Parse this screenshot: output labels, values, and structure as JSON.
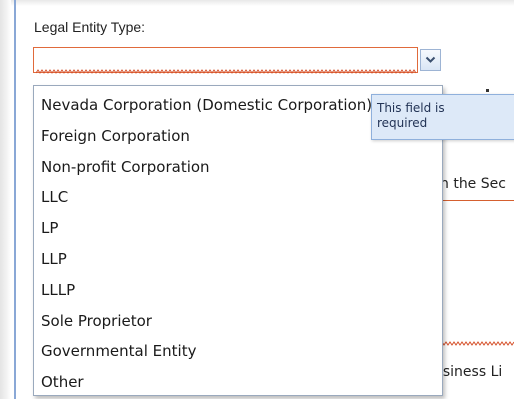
{
  "form": {
    "legal_entity_label": "Legal Entity Type:",
    "selected_value": ""
  },
  "dropdown": {
    "options": [
      "Nevada Corporation (Domestic Corporation)",
      "Foreign Corporation",
      "Non-profit Corporation",
      "LLC",
      "LP",
      "LLP",
      "LLLP",
      "Sole Proprietor",
      "Governmental Entity",
      "Other"
    ]
  },
  "validation": {
    "tooltip_text": "This field is required"
  },
  "background": {
    "fragment_1": "n the Sec",
    "fragment_2": "usiness Li"
  },
  "colors": {
    "error_border": "#e06a3b",
    "tooltip_bg": "#dde9f8",
    "tooltip_border": "#8fb0dc",
    "dropdown_border": "#9aa9bd",
    "accent_rail": "#8aa8d6"
  },
  "icons": {
    "dropdown_arrow": "chevron-down-icon",
    "invalid_underline": "squiggle-underline"
  }
}
